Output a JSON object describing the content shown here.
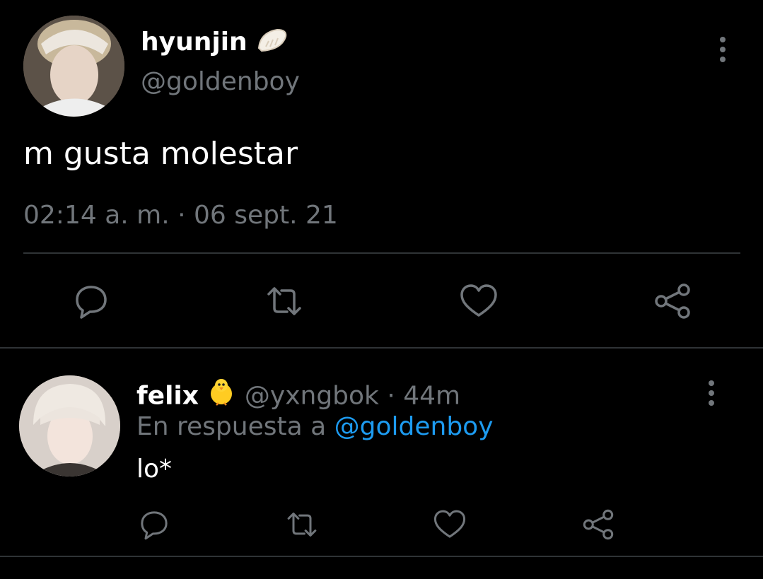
{
  "main_tweet": {
    "author_name": "hyunjin",
    "author_emoji": "dumpling-emoji",
    "author_handle": "@goldenboy",
    "text": "m gusta molestar",
    "timestamp": "02:14 a. m. · 06 sept. 21"
  },
  "reply": {
    "author_name": "felix",
    "author_emoji": "chick-emoji",
    "author_handle": "@yxngbok",
    "separator": " · ",
    "time": "44m",
    "reply_prefix": "En respuesta a ",
    "reply_to_handle": "@goldenboy",
    "text": "lo*"
  },
  "colors": {
    "background": "#000000",
    "text_primary": "#ffffff",
    "text_secondary": "#71767b",
    "link": "#1d9bf0",
    "divider": "#2f3336"
  },
  "icons": [
    "reply-icon",
    "retweet-icon",
    "like-icon",
    "share-icon",
    "more-options-icon"
  ]
}
